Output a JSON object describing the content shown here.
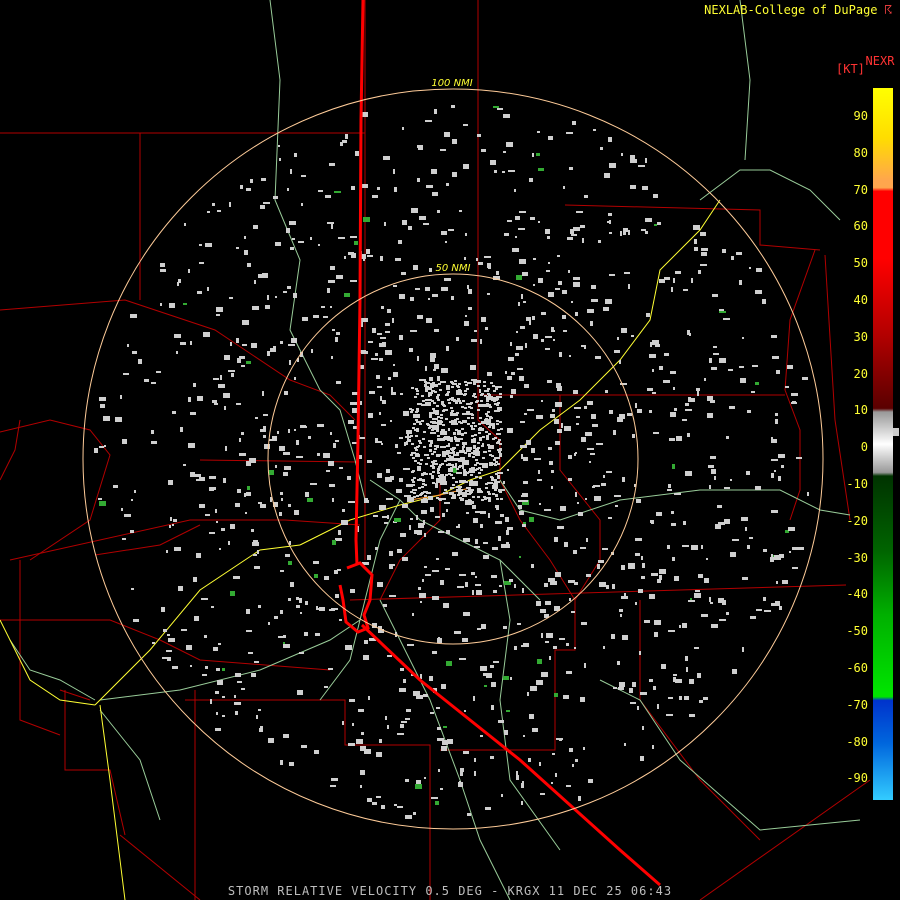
{
  "header": {
    "credit": "NEXLAB-College of DuPage",
    "credit_mark": "☈"
  },
  "legend": {
    "product": "NEXR",
    "unit": "[KT]",
    "ticks": [
      "90",
      "80",
      "70",
      "60",
      "50",
      "40",
      "30",
      "20",
      "10",
      "0",
      "-10",
      "-20",
      "-30",
      "-40",
      "-50",
      "-60",
      "-70",
      "-80",
      "-90"
    ],
    "colors": [
      "#ffff00",
      "#ffa64d",
      "#ff0000",
      "#8b0000",
      "#999999",
      "#006400",
      "#00e400",
      "#0033cc",
      "#33ccff"
    ]
  },
  "map": {
    "rings": [
      "100 NMI",
      "50 NMI"
    ],
    "colors": {
      "county": "#b20000",
      "highway": "#ff0000",
      "road": "#99cc99",
      "interstate": "#ffff33",
      "ring": "#ffcc99",
      "echo": "#cfcfcf"
    }
  },
  "footer": {
    "caption": "STORM RELATIVE VELOCITY 0.5 DEG - KRGX 11 DEC 25 06:43"
  }
}
